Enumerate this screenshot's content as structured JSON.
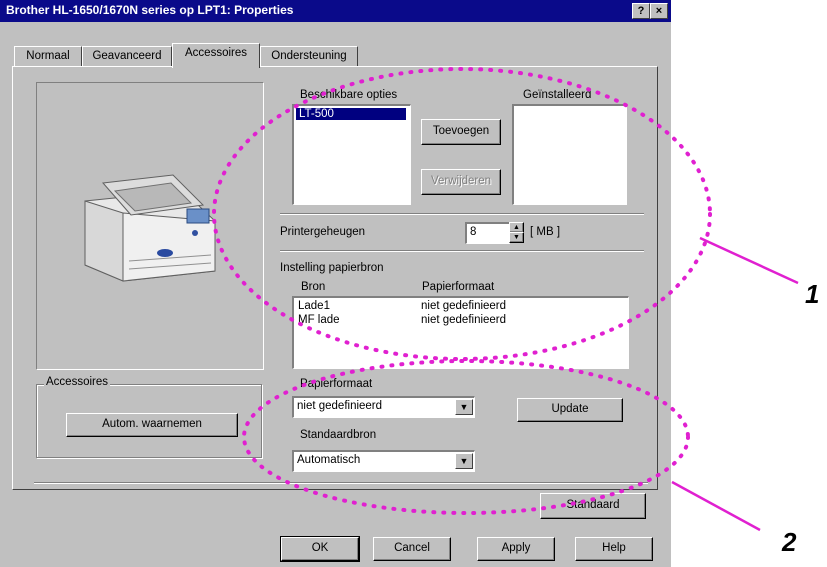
{
  "window": {
    "title": "Brother HL-1650/1670N series op LPT1: Properties",
    "help_button": "?",
    "close_button": "×"
  },
  "tabs": [
    {
      "label": "Normaal"
    },
    {
      "label": "Geavanceerd"
    },
    {
      "label": "Accessoires"
    },
    {
      "label": "Ondersteuning"
    }
  ],
  "options": {
    "available_label": "Beschikbare opties",
    "available_items": [
      "LT-500"
    ],
    "installed_label": "Geïnstalleerd",
    "installed_items": [],
    "add_button": "Toevoegen",
    "remove_button": "Verwijderen"
  },
  "memory": {
    "label": "Printergeheugen",
    "value": "8",
    "unit": "[ MB ]"
  },
  "paper_source": {
    "label": "Instelling papierbron",
    "col_source": "Bron",
    "col_format": "Papierformaat",
    "rows": [
      {
        "source": "Lade1",
        "format": "niet gedefinieerd"
      },
      {
        "source": "MF lade",
        "format": "niet gedefinieerd"
      }
    ]
  },
  "paper_format": {
    "label": "Papierformaat",
    "value": "niet gedefinieerd",
    "update_button": "Update"
  },
  "default_source": {
    "label": "Standaardbron",
    "value": "Automatisch"
  },
  "accessories_group": {
    "label": "Accessoires",
    "autodetect_button": "Autom. waarnemen"
  },
  "buttons": {
    "standard": "Standaard",
    "ok": "OK",
    "cancel": "Cancel",
    "apply": "Apply",
    "help": "Help"
  },
  "callouts": {
    "one": "1",
    "two": "2"
  },
  "colors": {
    "titlebar": "#0a0a8a",
    "dialog": "#c0c0c0",
    "selection": "#000080",
    "annotation_dots": "#e020d0",
    "annotation_lines": "#e020d0"
  }
}
